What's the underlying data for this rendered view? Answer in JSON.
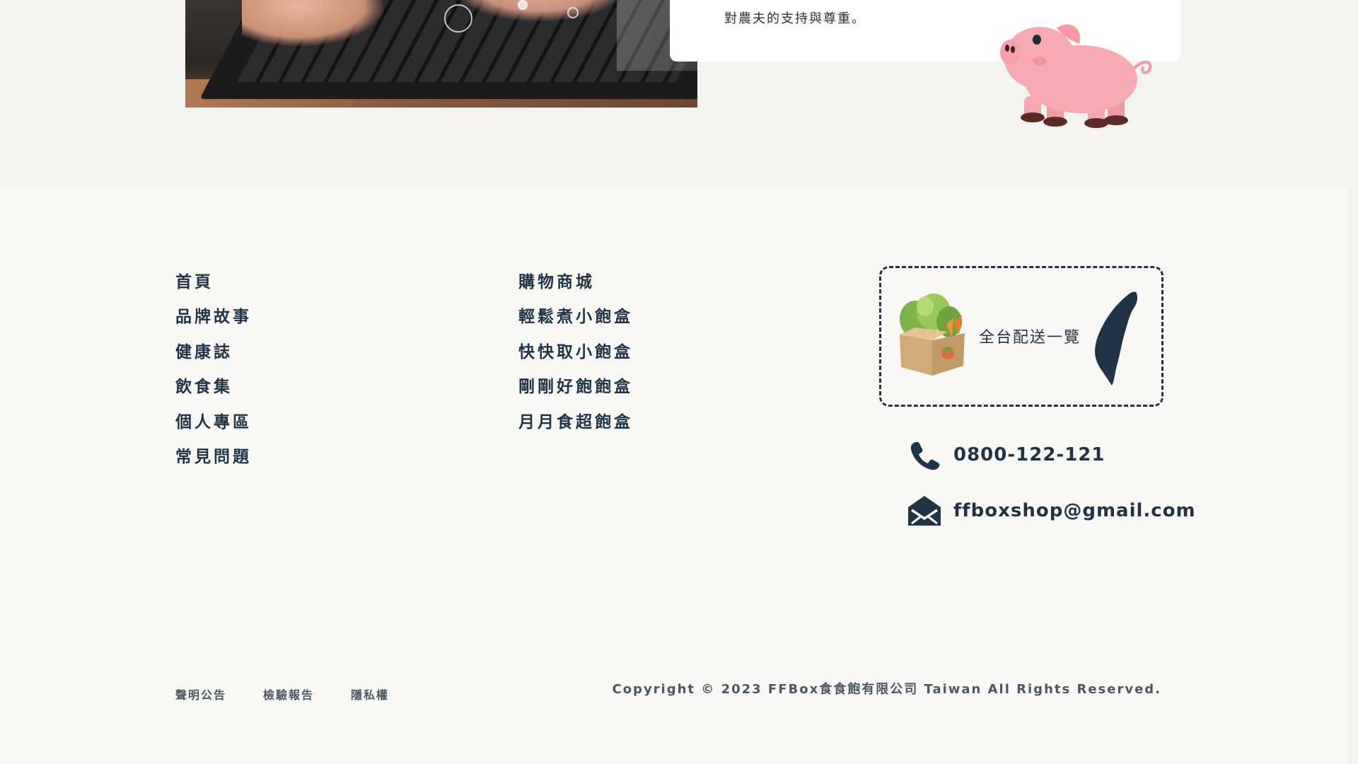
{
  "intro": {
    "card_text": "對農夫的支持與尊重。"
  },
  "footer": {
    "nav_left": [
      {
        "label": "首頁"
      },
      {
        "label": "品牌故事"
      },
      {
        "label": "健康誌"
      },
      {
        "label": "飲食集"
      },
      {
        "label": "個人專區"
      },
      {
        "label": "常見問題"
      }
    ],
    "nav_right": [
      {
        "label": "購物商城"
      },
      {
        "label": "輕鬆煮小飽盒"
      },
      {
        "label": "快快取小飽盒"
      },
      {
        "label": "剛剛好飽飽盒"
      },
      {
        "label": "月月食超飽盒"
      }
    ],
    "delivery": {
      "label": "全台配送一覽"
    },
    "contact": {
      "phone": "0800-122-121",
      "email": "ffboxshop@gmail.com"
    },
    "legal_links": [
      {
        "label": "聲明公告"
      },
      {
        "label": "檢驗報告"
      },
      {
        "label": "隱私權"
      }
    ],
    "copyright": "Copyright © 2023 FFBox食食飽有限公司 Taiwan All Rights Reserved."
  },
  "colors": {
    "navy": "#1f3447",
    "pig_pink": "#f6a6ae",
    "page_bg": "#f4f3f0",
    "footer_bg": "#faf8f5"
  },
  "icons": [
    "phone-icon",
    "mail-icon",
    "taiwan-map-icon",
    "vegetable-box-icon",
    "pig-illustration"
  ]
}
